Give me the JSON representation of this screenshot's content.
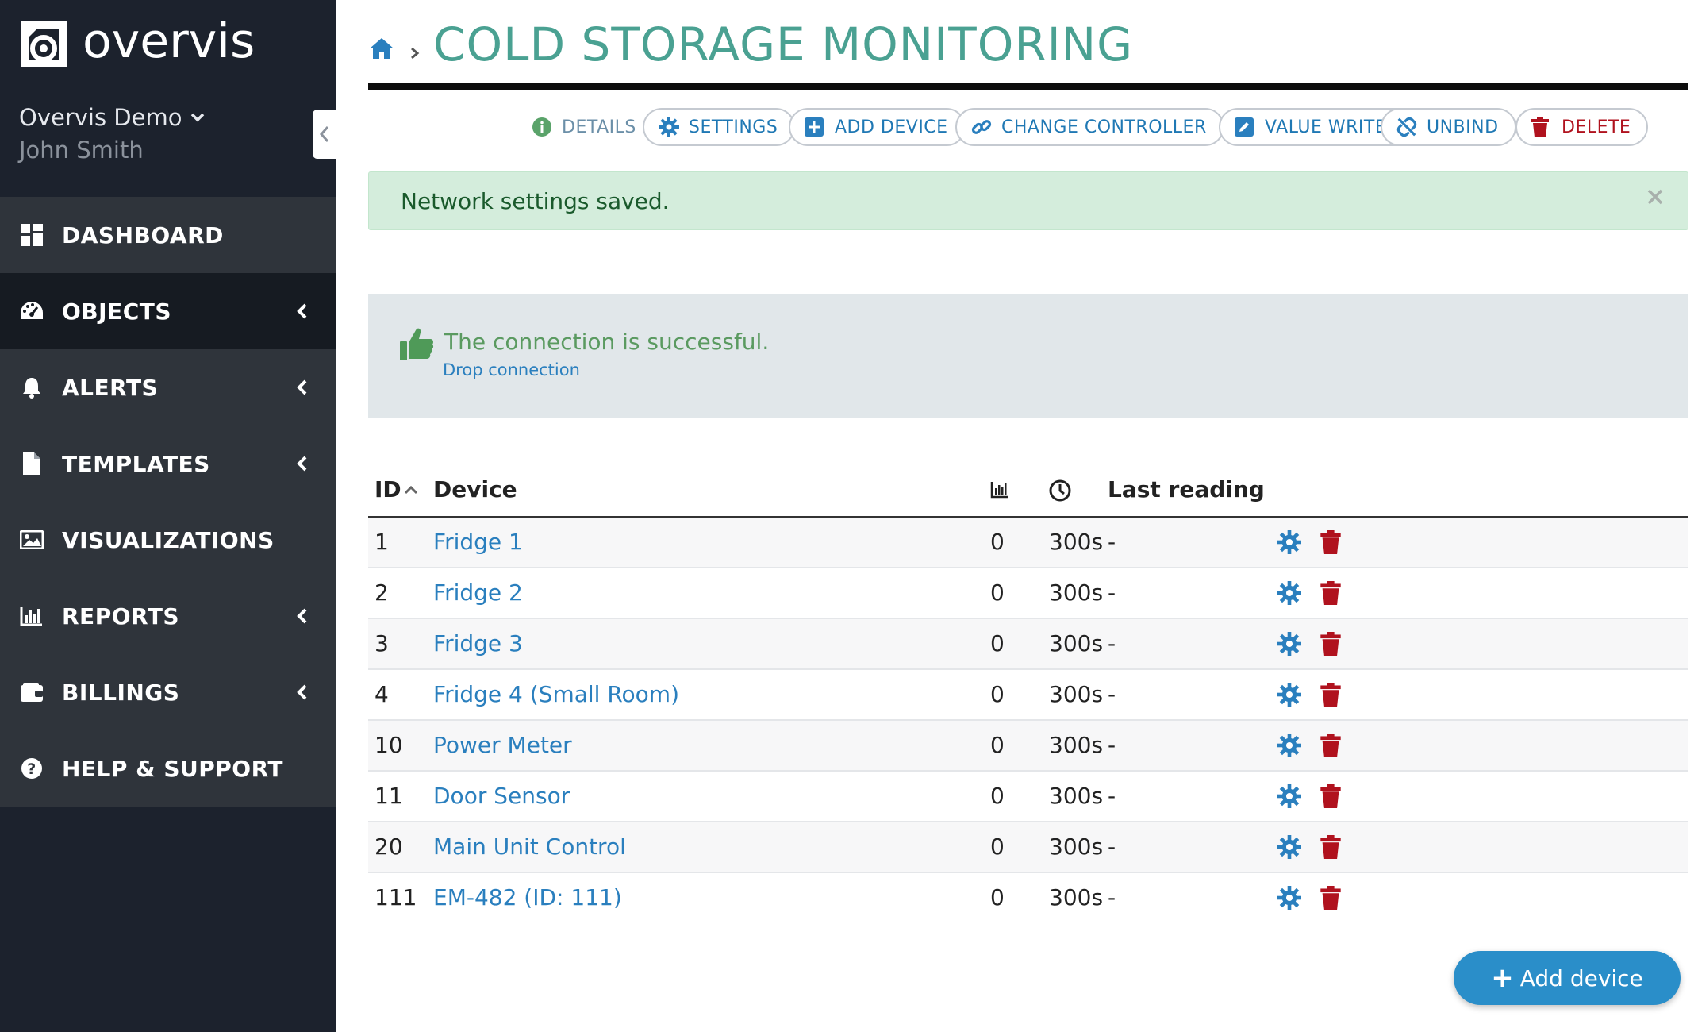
{
  "brand": {
    "name": "overvis"
  },
  "user": {
    "org": "Overvis Demo",
    "name": "John Smith"
  },
  "sidebar": {
    "items": [
      {
        "label": "DASHBOARD",
        "icon": "dashboard-icon"
      },
      {
        "label": "OBJECTS",
        "icon": "gauge-icon"
      },
      {
        "label": "ALERTS",
        "icon": "bell-icon"
      },
      {
        "label": "TEMPLATES",
        "icon": "file-icon"
      },
      {
        "label": "VISUALIZATIONS",
        "icon": "image-icon"
      },
      {
        "label": "REPORTS",
        "icon": "bar-chart-icon"
      },
      {
        "label": "BILLINGS",
        "icon": "wallet-icon"
      },
      {
        "label": "HELP & SUPPORT",
        "icon": "question-icon"
      }
    ]
  },
  "header": {
    "title": "COLD STORAGE MONITORING"
  },
  "toolbar": {
    "details": "DETAILS",
    "settings": "SETTINGS",
    "add_device": "ADD DEVICE",
    "change_controller": "CHANGE CONTROLLER",
    "value_writes_log": "VALUE WRITES LOG",
    "unbind": "UNBIND",
    "delete": "DELETE"
  },
  "alert": {
    "message": "Network settings saved."
  },
  "connection": {
    "message": "The connection is successful.",
    "drop": "Drop connection"
  },
  "table": {
    "headers": {
      "id": "ID",
      "device": "Device",
      "last_reading": "Last reading"
    },
    "rows": [
      {
        "id": "1",
        "device": "Fridge 1",
        "values": "0",
        "interval": "300s",
        "last": "-"
      },
      {
        "id": "2",
        "device": "Fridge 2",
        "values": "0",
        "interval": "300s",
        "last": "-"
      },
      {
        "id": "3",
        "device": "Fridge 3",
        "values": "0",
        "interval": "300s",
        "last": "-"
      },
      {
        "id": "4",
        "device": "Fridge 4 (Small Room)",
        "values": "0",
        "interval": "300s",
        "last": "-"
      },
      {
        "id": "10",
        "device": "Power Meter",
        "values": "0",
        "interval": "300s",
        "last": "-"
      },
      {
        "id": "11",
        "device": "Door Sensor",
        "values": "0",
        "interval": "300s",
        "last": "-"
      },
      {
        "id": "20",
        "device": "Main Unit Control",
        "values": "0",
        "interval": "300s",
        "last": "-"
      },
      {
        "id": "111",
        "device": "EM-482 (ID: 111)",
        "values": "0",
        "interval": "300s",
        "last": "-"
      }
    ]
  },
  "actions": {
    "add_device": "Add device"
  },
  "colors": {
    "accent": "#4aa192",
    "link": "#2a7fbe",
    "danger": "#b0121e",
    "sidebar": "#1c222d"
  }
}
